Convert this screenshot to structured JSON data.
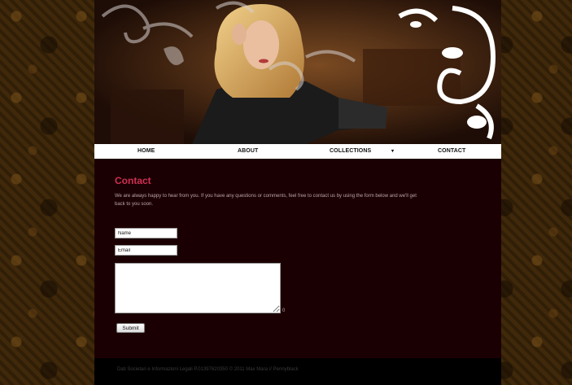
{
  "nav": {
    "items": [
      {
        "label": "HOME"
      },
      {
        "label": "ABOUT"
      },
      {
        "label": "COLLECTIONS"
      },
      {
        "label": "CONTACT"
      }
    ],
    "dropdown_caret": "▾"
  },
  "content": {
    "heading": "Contact",
    "intro": "We are always happy to hear from you. If you have any questions or comments, feel free to contact us by using the form below and we'll get back to you soon."
  },
  "form": {
    "name_placeholder": "Name",
    "email_placeholder": "Email",
    "message_value": "",
    "char_count": "0",
    "submit_label": "Submit"
  },
  "footer": {
    "text": "Dati Societari e Informazioni Legali P.01397620350 © 2011 Max Mara // Pennyblack"
  },
  "colors": {
    "heading": "#cf2f53",
    "page_background": "#1b0003",
    "nav_background": "#ffffff",
    "footer_background": "#000000"
  },
  "icons": {
    "dropdown": "chevron-down-icon",
    "resize": "resize-grip-icon"
  }
}
